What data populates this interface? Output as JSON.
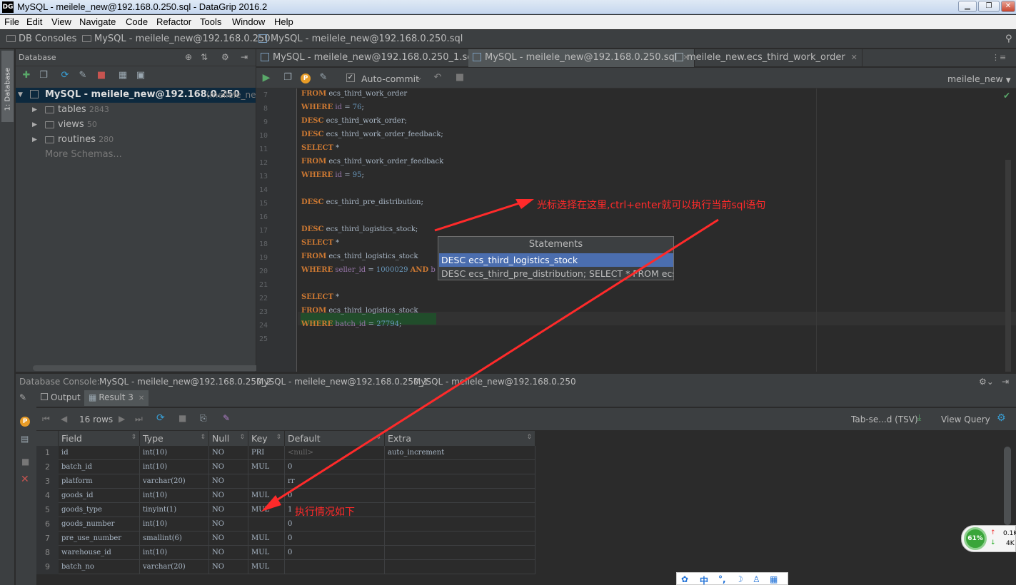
{
  "window": {
    "title": "MySQL - meilele_new@192.168.0.250.sql - DataGrip 2016.2",
    "app_icon": "DG"
  },
  "menu": [
    "File",
    "Edit",
    "View",
    "Navigate",
    "Code",
    "Refactor",
    "Tools",
    "Window",
    "Help"
  ],
  "breadcrumb": [
    "DB Consoles",
    "MySQL - meilele_new@192.168.0.250",
    "MySQL - meilele_new@192.168.0.250.sql"
  ],
  "side_tab": "1: Database",
  "db_panel": {
    "title": "Database",
    "root": "MySQL - meilele_new@192.168.0.250",
    "root_suffix": "(meilele_new",
    "nodes": [
      {
        "label": "tables",
        "count": "2843"
      },
      {
        "label": "views",
        "count": "50"
      },
      {
        "label": "routines",
        "count": "280"
      }
    ],
    "more": "More Schemas..."
  },
  "editor_tabs": [
    {
      "label": "MySQL - meilele_new@192.168.0.250_1.sql",
      "active": false
    },
    {
      "label": "MySQL - meilele_new@192.168.0.250.sql",
      "active": true
    },
    {
      "label": "meilele_new.ecs_third_work_order",
      "active": false
    }
  ],
  "editor_toolbar": {
    "auto_commit": "Auto-commit",
    "schema": "meilele_new"
  },
  "code": {
    "line_numbers": [
      "7",
      "8",
      "9",
      "10",
      "11",
      "12",
      "13",
      "14",
      "15",
      "16",
      "17",
      "18",
      "19",
      "20",
      "21",
      "22",
      "23",
      "24",
      "25"
    ],
    "lines": [
      [
        {
          "k": "kw",
          "t": "FROM"
        },
        {
          "k": "",
          "t": " ecs_third_work_order"
        }
      ],
      [
        {
          "k": "kw",
          "t": "WHERE"
        },
        {
          "k": "",
          "t": " "
        },
        {
          "k": "id",
          "t": "id"
        },
        {
          "k": "",
          "t": " = "
        },
        {
          "k": "num",
          "t": "76"
        },
        {
          "k": "",
          "t": ";"
        }
      ],
      [
        {
          "k": "kw",
          "t": "DESC"
        },
        {
          "k": "",
          "t": " ecs_third_work_order;"
        }
      ],
      [
        {
          "k": "kw",
          "t": "DESC"
        },
        {
          "k": "",
          "t": " ecs_third_work_order_feedback;"
        }
      ],
      [
        {
          "k": "kw",
          "t": "SELECT"
        },
        {
          "k": "",
          "t": " *"
        }
      ],
      [
        {
          "k": "kw",
          "t": "FROM"
        },
        {
          "k": "",
          "t": " ecs_third_work_order_feedback"
        }
      ],
      [
        {
          "k": "kw",
          "t": "WHERE"
        },
        {
          "k": "",
          "t": " "
        },
        {
          "k": "id",
          "t": "id"
        },
        {
          "k": "",
          "t": " = "
        },
        {
          "k": "num",
          "t": "95"
        },
        {
          "k": "",
          "t": ";"
        }
      ],
      [],
      [
        {
          "k": "kw",
          "t": "DESC"
        },
        {
          "k": "",
          "t": " ecs_third_pre_distribution;"
        }
      ],
      [],
      [
        {
          "k": "kw",
          "t": "DESC"
        },
        {
          "k": "",
          "t": " ecs_third_logistics_stock;"
        }
      ],
      [
        {
          "k": "kw",
          "t": "SELECT"
        },
        {
          "k": "",
          "t": " *"
        }
      ],
      [
        {
          "k": "kw",
          "t": "FROM"
        },
        {
          "k": "",
          "t": " ecs_third_logistics_stock"
        }
      ],
      [
        {
          "k": "kw",
          "t": "WHERE"
        },
        {
          "k": "",
          "t": " "
        },
        {
          "k": "id",
          "t": "seller_id"
        },
        {
          "k": "",
          "t": " = "
        },
        {
          "k": "num",
          "t": "1000029"
        },
        {
          "k": "",
          "t": " "
        },
        {
          "k": "kw",
          "t": "AND"
        },
        {
          "k": "",
          "t": " "
        },
        {
          "k": "id",
          "t": "b"
        }
      ],
      [],
      [
        {
          "k": "kw",
          "t": "SELECT"
        },
        {
          "k": "",
          "t": " *"
        }
      ],
      [
        {
          "k": "kw",
          "t": "FROM"
        },
        {
          "k": "",
          "t": " ecs_third_logistics_stock"
        }
      ],
      [
        {
          "k": "kw",
          "t": "WHERE"
        },
        {
          "k": "",
          "t": " "
        },
        {
          "k": "id",
          "t": "batch_id"
        },
        {
          "k": "",
          "t": " = "
        },
        {
          "k": "num",
          "t": "27794"
        },
        {
          "k": "",
          "t": ";"
        }
      ],
      []
    ]
  },
  "popup": {
    "title": "Statements",
    "items": [
      "DESC ecs_third_logistics_stock",
      "DESC ecs_third_pre_distribution; SELECT * FROM ecs..."
    ]
  },
  "annotations": {
    "top": "光标选择在这里,ctrl+enter就可以执行当前sql语句",
    "bottom": "执行情况如下"
  },
  "console_bar": {
    "label": "Database Console:",
    "items": [
      "MySQL - meilele_new@192.168.0.250_2",
      "MySQL - meilele_new@192.168.0.250_1",
      "MySQL - meilele_new@192.168.0.250"
    ]
  },
  "result_tabs": [
    "Output",
    "Result 3"
  ],
  "result_toolbar": {
    "rows": "16 rows",
    "format": "Tab-se...d (TSV)",
    "view_query": "View Query"
  },
  "grid": {
    "columns": [
      "Field",
      "Type",
      "Null",
      "Key",
      "Default",
      "Extra"
    ],
    "rows": [
      [
        "1",
        "id",
        "int(10)",
        "NO",
        "PRI",
        "<null>",
        "auto_increment"
      ],
      [
        "2",
        "batch_id",
        "int(10)",
        "NO",
        "MUL",
        "0",
        ""
      ],
      [
        "3",
        "platform",
        "varchar(20)",
        "NO",
        "",
        "rr",
        ""
      ],
      [
        "4",
        "goods_id",
        "int(10)",
        "NO",
        "MUL",
        "0",
        ""
      ],
      [
        "5",
        "goods_type",
        "tinyint(1)",
        "NO",
        "MUL",
        "1",
        ""
      ],
      [
        "6",
        "goods_number",
        "int(10)",
        "NO",
        "",
        "0",
        ""
      ],
      [
        "7",
        "pre_use_number",
        "smallint(6)",
        "NO",
        "MUL",
        "0",
        ""
      ],
      [
        "8",
        "warehouse_id",
        "int(10)",
        "NO",
        "MUL",
        "0",
        ""
      ],
      [
        "9",
        "batch_no",
        "varchar(20)",
        "NO",
        "MUL",
        "",
        ""
      ]
    ]
  },
  "net_monitor": {
    "percent": "61%",
    "up": "0.1K",
    "down": "4K"
  },
  "colors": {
    "accent": "#4b6eaf",
    "annotation": "#ff2a2a",
    "keyword": "#cc7832"
  }
}
